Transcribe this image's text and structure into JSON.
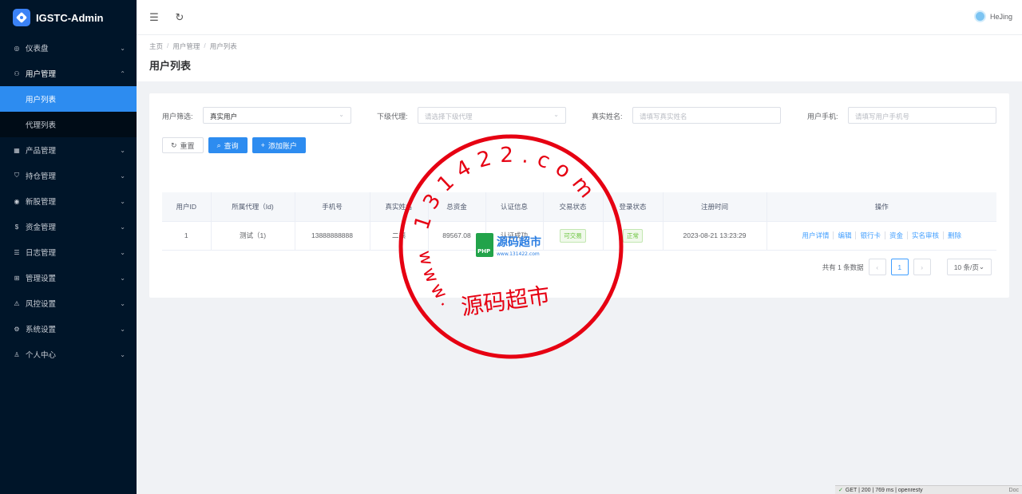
{
  "app": {
    "title": "IGSTC-Admin"
  },
  "sidebar": {
    "items": [
      {
        "icon": "dashboard-icon",
        "glyph": "◎",
        "label": "仪表盘",
        "chevron": "⌄"
      },
      {
        "icon": "user-group-icon",
        "glyph": "⚇",
        "label": "用户管理",
        "chevron": "⌃",
        "open": true,
        "children": [
          {
            "label": "用户列表",
            "active": true
          },
          {
            "label": "代理列表"
          }
        ]
      },
      {
        "icon": "chart-icon",
        "glyph": "▦",
        "label": "产品管理",
        "chevron": "⌄"
      },
      {
        "icon": "position-icon",
        "glyph": "⛉",
        "label": "持仓管理",
        "chevron": "⌄"
      },
      {
        "icon": "signal-icon",
        "glyph": "◉",
        "label": "新股管理",
        "chevron": "⌄"
      },
      {
        "icon": "money-icon",
        "glyph": "$",
        "label": "资金管理",
        "chevron": "⌄"
      },
      {
        "icon": "log-icon",
        "glyph": "☰",
        "label": "日志管理",
        "chevron": "⌄"
      },
      {
        "icon": "admin-icon",
        "glyph": "⊞",
        "label": "管理设置",
        "chevron": "⌄"
      },
      {
        "icon": "warning-icon",
        "glyph": "⚠",
        "label": "风控设置",
        "chevron": "⌄"
      },
      {
        "icon": "gear-icon",
        "glyph": "⚙",
        "label": "系统设置",
        "chevron": "⌄"
      },
      {
        "icon": "person-icon",
        "glyph": "♙",
        "label": "个人中心",
        "chevron": "⌄"
      }
    ]
  },
  "header": {
    "collapse_glyph": "☰",
    "refresh_glyph": "↻",
    "user_name": "HeJing"
  },
  "breadcrumb": [
    "主页",
    "用户管理",
    "用户列表"
  ],
  "page_title": "用户列表",
  "filters": {
    "user_filter_label": "用户筛选:",
    "user_filter_value": "真实用户",
    "agent_label": "下级代理:",
    "agent_placeholder": "请选择下级代理",
    "realname_label": "真实姓名:",
    "realname_placeholder": "请填写真实姓名",
    "phone_label": "用户手机:",
    "phone_placeholder": "请填写用户手机号",
    "dropdown_glyph": "⌄"
  },
  "buttons": {
    "reset": "重置",
    "reset_glyph": "↻",
    "search": "查询",
    "search_glyph": "⌕",
    "add": "添加账户",
    "add_glyph": "+"
  },
  "table": {
    "headers": [
      "用户ID",
      "所属代理（Id)",
      "手机号",
      "真实姓名",
      "总资金",
      "认证信息",
      "交易状态",
      "登录状态",
      "注册时间",
      "操作"
    ],
    "rows": [
      {
        "id": "1",
        "agent": "测试（1)",
        "phone": "13888888888",
        "name": "二姨",
        "funds": "89567.08",
        "auth": "认证成功",
        "trade_status": "可交易",
        "login_status": "正常",
        "reg_time": "2023-08-21 13:23:29",
        "actions": [
          "用户详情",
          "编辑",
          "银行卡",
          "资金",
          "实名审核",
          "删除"
        ]
      }
    ]
  },
  "pager": {
    "total_text": "共有 1 条数据",
    "prev": "‹",
    "current": "1",
    "next": "›",
    "page_size": "10 条/页",
    "size_glyph": "⌄"
  },
  "debug_bar": {
    "ok_glyph": "✓",
    "text": "GET | 200 | 769 ms | openresty",
    "doc": "Doc"
  },
  "watermark": {
    "stamp_text": "131422.com",
    "stamp_site": "www.",
    "stamp_name": "源码超市",
    "logo_badge": "PHP",
    "logo_title": "源码超市",
    "logo_url": "www.131422.com",
    "color": "#e60012"
  },
  "colors": {
    "sidebar_bg": "#001529",
    "primary": "#2d8cf0",
    "success": "#67c23a"
  }
}
